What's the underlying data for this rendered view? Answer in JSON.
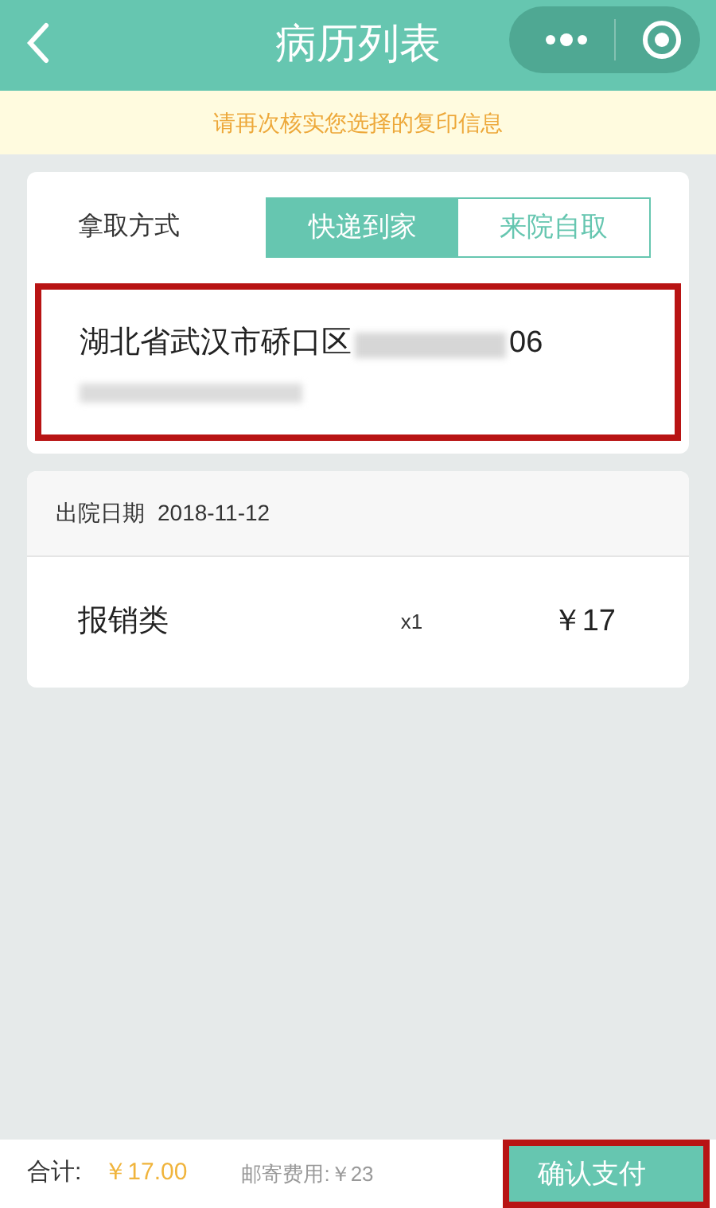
{
  "nav_bar": {
    "title": "病历列表"
  },
  "notice": "请再次核实您选择的复印信息",
  "pickup": {
    "label": "拿取方式",
    "options": [
      {
        "label": "快递到家",
        "selected": true
      },
      {
        "label": "来院自取",
        "selected": false
      }
    ]
  },
  "address": {
    "line_start": "湖北省武汉市硚口区",
    "line_end": "06"
  },
  "record": {
    "discharge_label": "出院日期",
    "discharge_date": "2018-11-12",
    "items": [
      {
        "name": "报销类",
        "quantity": "x1",
        "price": "￥17"
      }
    ]
  },
  "footer": {
    "total_label": "合计:",
    "total": "￥17.00",
    "postage": "邮寄费用:￥23",
    "confirm_button": "确认支付"
  }
}
